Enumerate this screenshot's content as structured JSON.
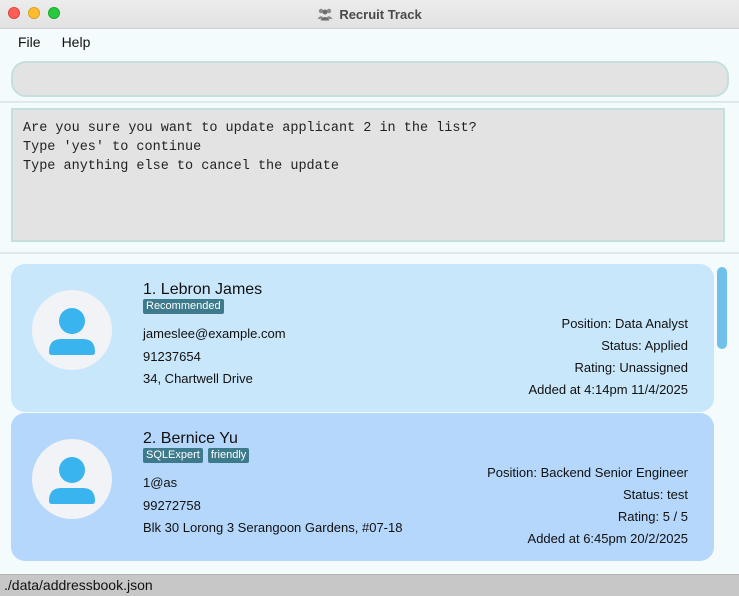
{
  "window": {
    "title": "Recruit Track"
  },
  "menu": {
    "file": "File",
    "help": "Help"
  },
  "command": {
    "value": ""
  },
  "result": {
    "text": "Are you sure you want to update applicant 2 in the list?\nType 'yes' to continue\nType anything else to cancel the update"
  },
  "applicants": [
    {
      "name": "1. Lebron James",
      "tags": [
        "Recommended"
      ],
      "email": "jameslee@example.com",
      "phone": "91237654",
      "address": "34, Chartwell Drive",
      "position": "Position:  Data Analyst",
      "status": "Status:  Applied",
      "rating": "Rating:  Unassigned",
      "added": "Added at 4:14pm 11/4/2025"
    },
    {
      "name": "2. Bernice Yu",
      "tags": [
        "SQLExpert",
        "friendly"
      ],
      "email": "1@as",
      "phone": "99272758",
      "address": "Blk 30 Lorong 3 Serangoon Gardens, #07-18",
      "position": "Position:  Backend Senior Engineer",
      "status": "Status:  test",
      "rating": "Rating:  5 / 5",
      "added": "Added at 6:45pm 20/2/2025"
    }
  ],
  "statusbar": {
    "path": "./data/addressbook.json"
  },
  "colors": {
    "card1": "#c9e7fb",
    "card2": "#b4d7fb",
    "tag": "#3d7a8c",
    "avatar_icon": "#3ab4ee"
  },
  "icons": [
    "close-icon",
    "minimize-icon",
    "maximize-icon",
    "app-people-icon",
    "person-avatar-icon"
  ]
}
